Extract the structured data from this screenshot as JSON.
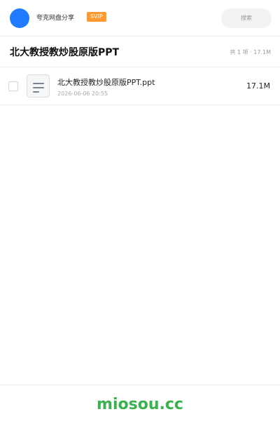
{
  "header": {
    "username": "夸克网盘分享",
    "badge": "SVIP",
    "search_label": "搜索"
  },
  "share": {
    "title": "北大教授教炒股原版PPT",
    "summary": "共 1 项 · 17.1M"
  },
  "files": [
    {
      "name": "北大教授教炒股原版PPT.ppt",
      "date": "2026-06-06 20:55",
      "size": "17.1M",
      "icon": "document-icon"
    }
  ],
  "footer": {
    "watermark": "miosou.cc"
  },
  "colors": {
    "avatar": "#1f7bff",
    "badge": "#ff9a2e",
    "watermark": "#37b24d"
  }
}
